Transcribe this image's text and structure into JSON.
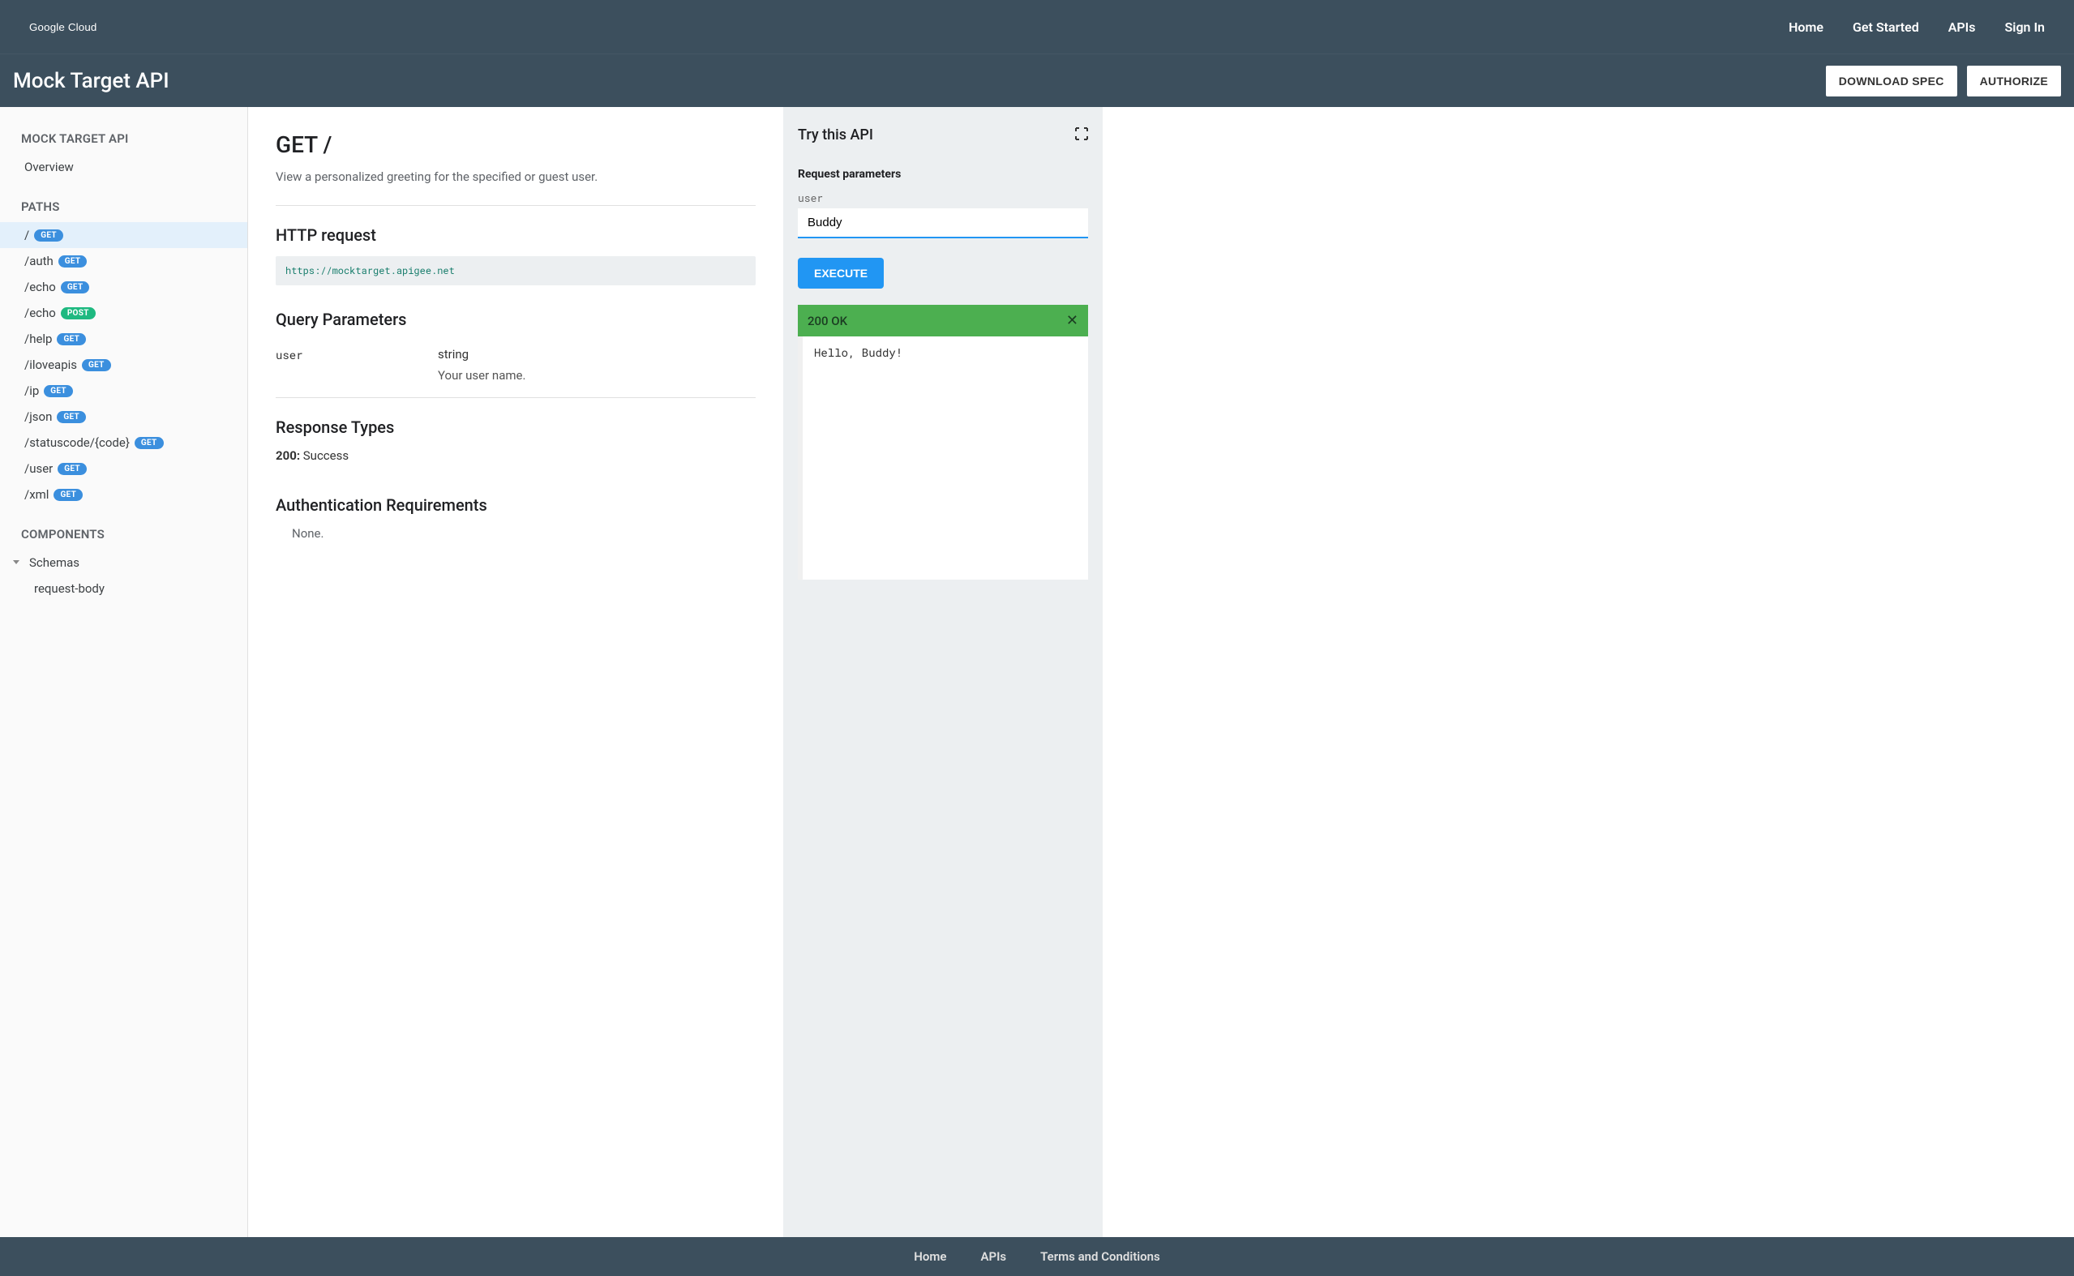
{
  "header": {
    "logo_text": "Google Cloud",
    "nav": {
      "home": "Home",
      "get_started": "Get Started",
      "apis": "APIs",
      "sign_in": "Sign In"
    }
  },
  "subheader": {
    "title": "Mock Target API",
    "download_spec": "DOWNLOAD SPEC",
    "authorize": "AUTHORIZE"
  },
  "sidebar": {
    "api_heading": "MOCK TARGET API",
    "overview": "Overview",
    "paths_heading": "PATHS",
    "paths": [
      {
        "path": "/",
        "method": "GET"
      },
      {
        "path": "/auth",
        "method": "GET"
      },
      {
        "path": "/echo",
        "method": "GET"
      },
      {
        "path": "/echo",
        "method": "POST"
      },
      {
        "path": "/help",
        "method": "GET"
      },
      {
        "path": "/iloveapis",
        "method": "GET"
      },
      {
        "path": "/ip",
        "method": "GET"
      },
      {
        "path": "/json",
        "method": "GET"
      },
      {
        "path": "/statuscode/{code}",
        "method": "GET"
      },
      {
        "path": "/user",
        "method": "GET"
      },
      {
        "path": "/xml",
        "method": "GET"
      }
    ],
    "components_heading": "COMPONENTS",
    "schemas_label": "Schemas",
    "schemas": [
      "request-body"
    ]
  },
  "content": {
    "title": "GET /",
    "description": "View a personalized greeting for the specified or guest user.",
    "http_request_heading": "HTTP request",
    "http_request_url": "https://mocktarget.apigee.net",
    "query_params_heading": "Query Parameters",
    "params": [
      {
        "name": "user",
        "type": "string",
        "desc": "Your user name."
      }
    ],
    "response_types_heading": "Response Types",
    "responses": [
      {
        "code": "200:",
        "label": " Success"
      }
    ],
    "auth_heading": "Authentication Requirements",
    "auth_none": "None."
  },
  "tryit": {
    "heading": "Try this API",
    "request_params_label": "Request parameters",
    "param_label": "user",
    "param_value": "Buddy",
    "execute_label": "EXECUTE",
    "response_status": "200 OK",
    "response_body": "Hello, Buddy!"
  },
  "footer": {
    "home": "Home",
    "apis": "APIs",
    "terms": "Terms and Conditions"
  }
}
